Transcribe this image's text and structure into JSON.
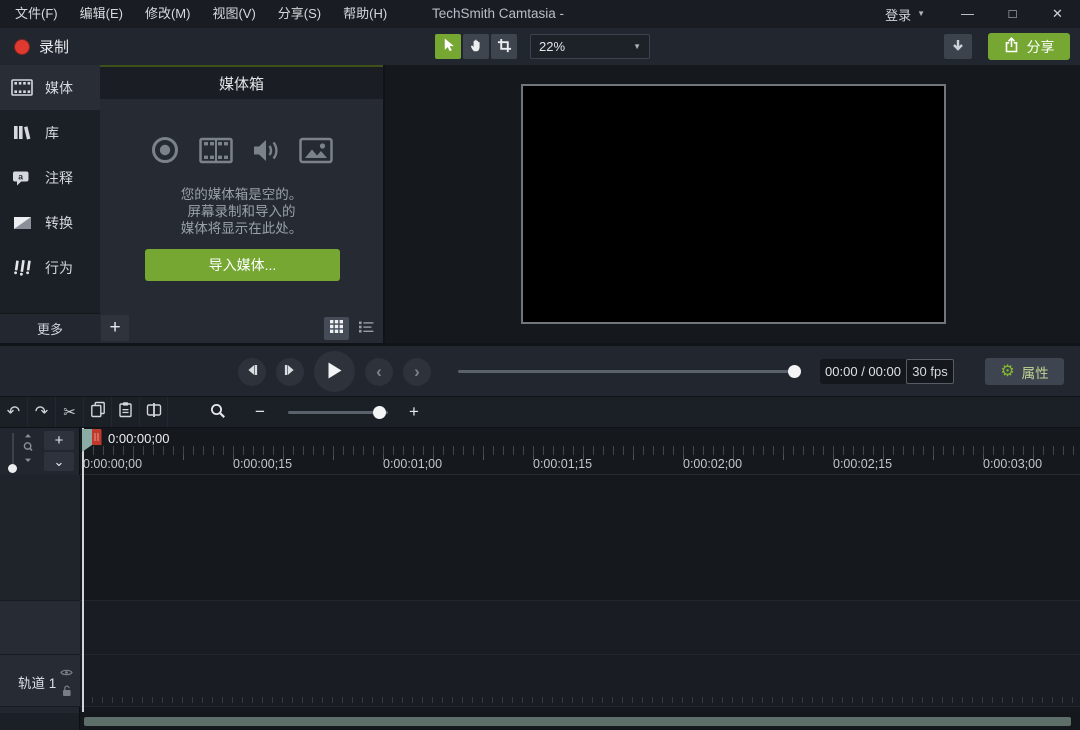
{
  "colors": {
    "accent_green": "#76a733",
    "record_red": "#e03a30",
    "playhead_teal": "#8aaca4",
    "playhead_red": "#c0392b",
    "scrollbar_thumb": "#5e6e69",
    "panel_bg": "#22262e",
    "deep_bg": "#15181d"
  },
  "menubar": {
    "items": [
      {
        "label": "文件(F)"
      },
      {
        "label": "编辑(E)"
      },
      {
        "label": "修改(M)"
      },
      {
        "label": "视图(V)"
      },
      {
        "label": "分享(S)"
      },
      {
        "label": "帮助(H)"
      }
    ],
    "title": "TechSmith Camtasia -",
    "signin_label": "登录",
    "window_controls": {
      "minimize": "—",
      "maximize": "□",
      "close": "✕"
    }
  },
  "toolbar": {
    "record_label": "录制",
    "zoom_value": "22%",
    "share_label": "分享"
  },
  "sidebar": {
    "items": [
      {
        "label": "媒体",
        "icon": "film-strip-icon",
        "selected": true
      },
      {
        "label": "库",
        "icon": "library-icon",
        "selected": false
      },
      {
        "label": "注释",
        "icon": "callout-icon",
        "selected": false
      },
      {
        "label": "转换",
        "icon": "transition-icon",
        "selected": false
      },
      {
        "label": "行为",
        "icon": "behaviors-icon",
        "selected": false
      }
    ],
    "more_label": "更多"
  },
  "media_bin": {
    "header": "媒体箱",
    "empty_icons": [
      "record-icon",
      "film-icon",
      "audio-icon",
      "image-icon"
    ],
    "empty_text_lines": [
      "您的媒体箱是空的。",
      "屏幕录制和导入的",
      "媒体将显示在此处。"
    ],
    "import_button_label": "导入媒体..."
  },
  "playback": {
    "time_display": "00:00 / 00:00",
    "fps_display": "30 fps",
    "properties_label": "属性"
  },
  "timeline": {
    "playhead_time": "0:00:00;00",
    "ruler_labels": [
      "0:00:00;00",
      "0:00:00;15",
      "0:00:01;00",
      "0:00:01;15",
      "0:00:02;00",
      "0:00:02;15",
      "0:00:03;00"
    ],
    "tracks": [
      {
        "label": "轨道 1"
      }
    ]
  },
  "glyphs": {
    "caret_down": "▼",
    "chevron_left": "‹",
    "chevron_right": "›",
    "chevron_down": "⌄",
    "undo": "↶",
    "redo": "↷",
    "cut": "✂",
    "minus": "−",
    "plus": "+",
    "add": "+",
    "gear": "⚙"
  }
}
